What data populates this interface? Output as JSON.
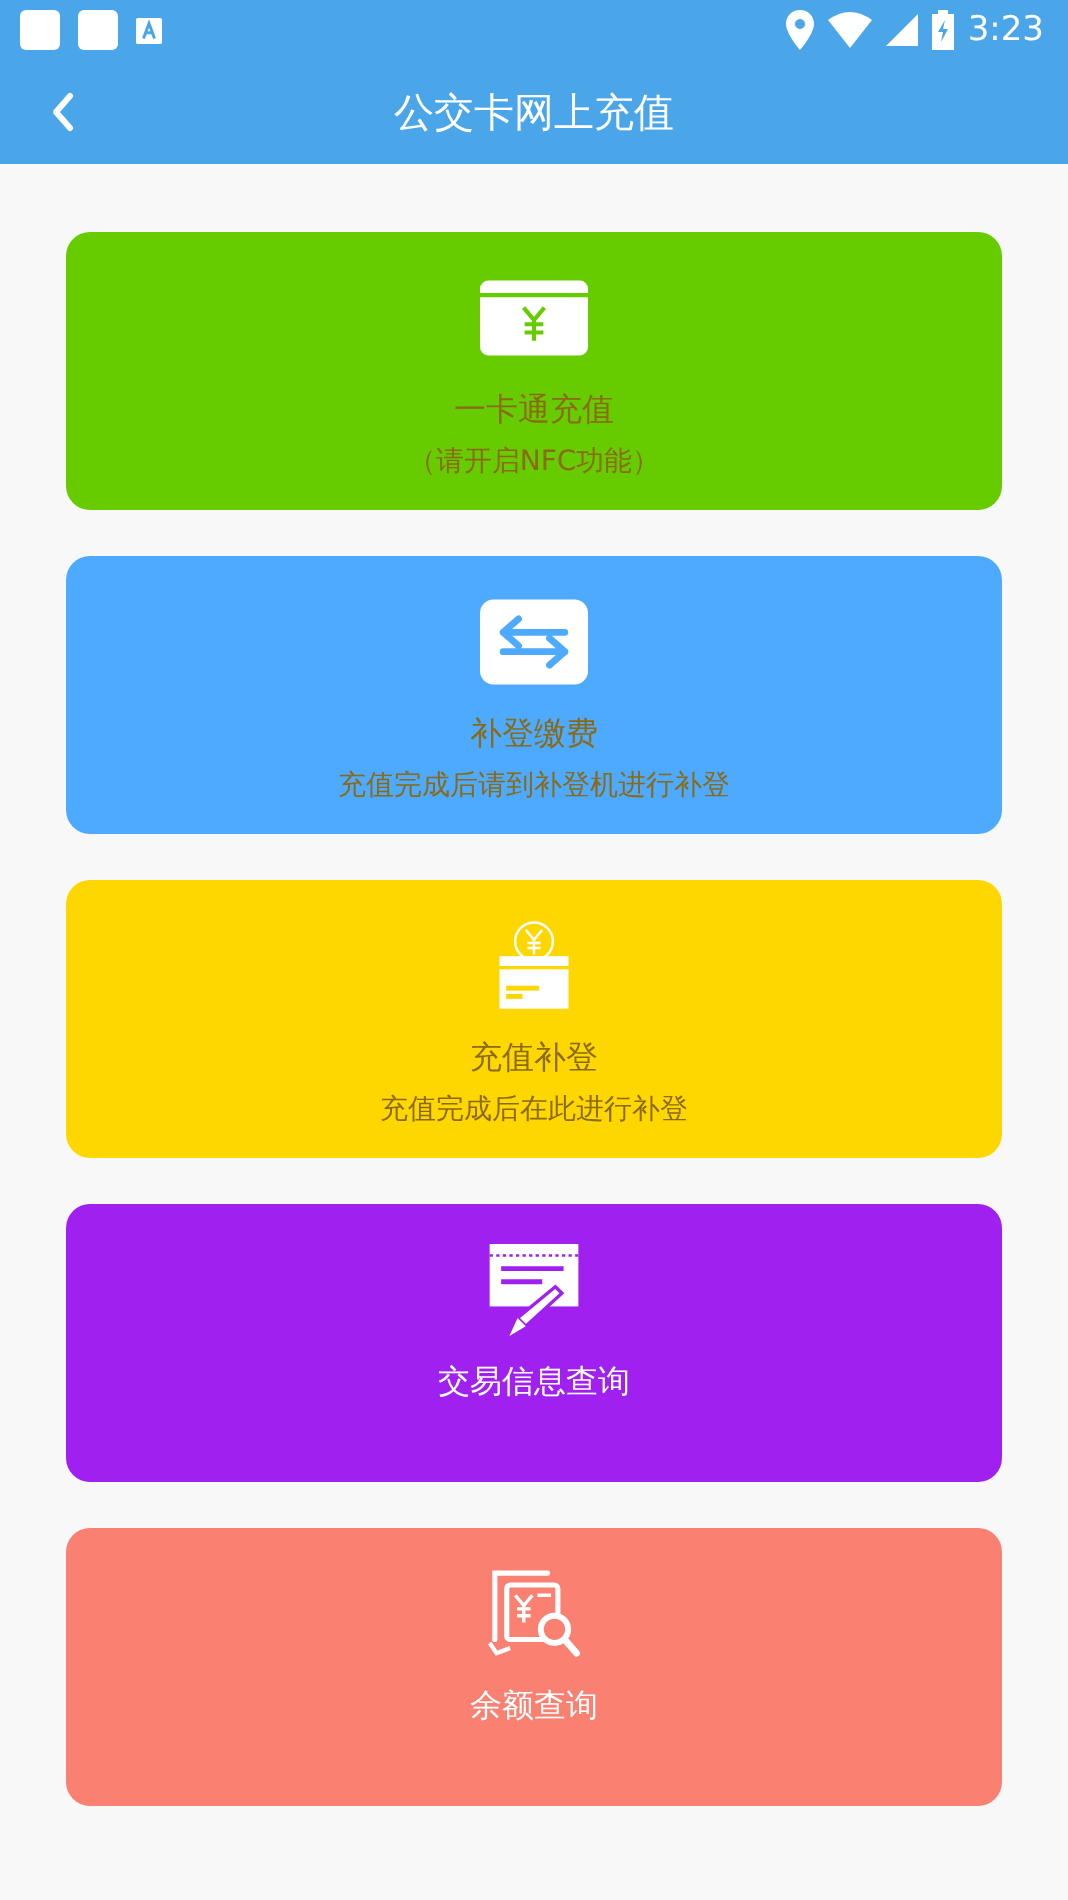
{
  "status_bar": {
    "time": "3:23"
  },
  "toolbar": {
    "title": "公交卡网上充值"
  },
  "cards": [
    {
      "kind": "card",
      "color": "#66cc00",
      "title": "一卡通充值",
      "subtitle": "（请开启NFC功能）"
    },
    {
      "kind": "transfer",
      "color": "#4eaaff",
      "title": "补登缴费",
      "subtitle": "充值完成后请到补登机进行补登"
    },
    {
      "kind": "coin",
      "color": "#ffd700",
      "title": "充值补登",
      "subtitle": "充值完成后在此进行补登"
    },
    {
      "kind": "receipt",
      "color": "#a020f0",
      "title": "交易信息查询"
    },
    {
      "kind": "search",
      "color": "#fa8072",
      "title": "余额查询"
    }
  ]
}
